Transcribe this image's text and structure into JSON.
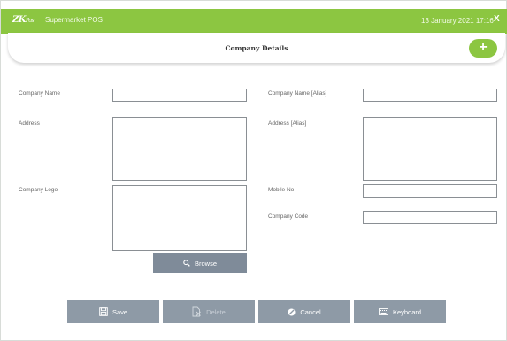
{
  "app": {
    "logo_main": "ZK",
    "logo_sub": "Pos",
    "title": "Supermarket POS",
    "datetime": "13 January 2021 17:16",
    "close_label": "X"
  },
  "header": {
    "title": "Company Details",
    "add_label": "+"
  },
  "form": {
    "company_name": {
      "label": "Company Name",
      "value": ""
    },
    "company_name_alias": {
      "label": "Company Name [Alias]",
      "value": ""
    },
    "address": {
      "label": "Address",
      "value": ""
    },
    "address_alias": {
      "label": "Address [Alias]",
      "value": ""
    },
    "company_logo": {
      "label": "Company Logo"
    },
    "mobile_no": {
      "label": "Mobile No",
      "value": ""
    },
    "company_code": {
      "label": "Company Code",
      "value": ""
    },
    "browse_label": "Browse"
  },
  "actions": {
    "save": "Save",
    "delete": "Delete",
    "cancel": "Cancel",
    "keyboard": "Keyboard"
  },
  "colors": {
    "accent": "#8cc641",
    "button": "#8e9aa6"
  }
}
